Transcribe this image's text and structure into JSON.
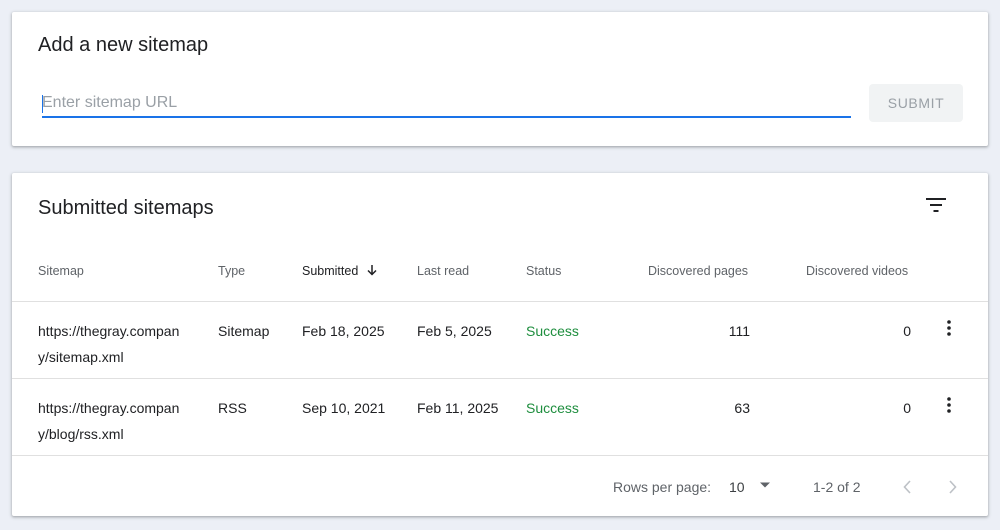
{
  "add_sitemap": {
    "title": "Add a new sitemap",
    "input_placeholder": "Enter sitemap URL",
    "input_value": "",
    "submit_label": "SUBMIT"
  },
  "submitted": {
    "title": "Submitted sitemaps",
    "filter_icon": "filter-icon",
    "columns": [
      {
        "label": "Sitemap"
      },
      {
        "label": "Type"
      },
      {
        "label": "Submitted",
        "sorted": "descending"
      },
      {
        "label": "Last read"
      },
      {
        "label": "Status"
      },
      {
        "label": "Discovered pages"
      },
      {
        "label": "Discovered videos"
      }
    ],
    "rows": [
      {
        "sitemap": "https://thegray.company/sitemap.xml",
        "type": "Sitemap",
        "submitted": "Feb 18, 2025",
        "last_read": "Feb 5, 2025",
        "status": "Success",
        "discovered_pages": "111",
        "discovered_videos": "0"
      },
      {
        "sitemap": "https://thegray.company/blog/rss.xml",
        "type": "RSS",
        "submitted": "Sep 10, 2021",
        "last_read": "Feb 11, 2025",
        "status": "Success",
        "discovered_pages": "63",
        "discovered_videos": "0"
      }
    ],
    "footer": {
      "rows_per_page_label": "Rows per page:",
      "rows_per_page_value": "10",
      "range": "1-2 of 2"
    }
  },
  "colors": {
    "accent": "#1a73e8",
    "success": "#1e8e3e",
    "background": "#eceff6"
  }
}
